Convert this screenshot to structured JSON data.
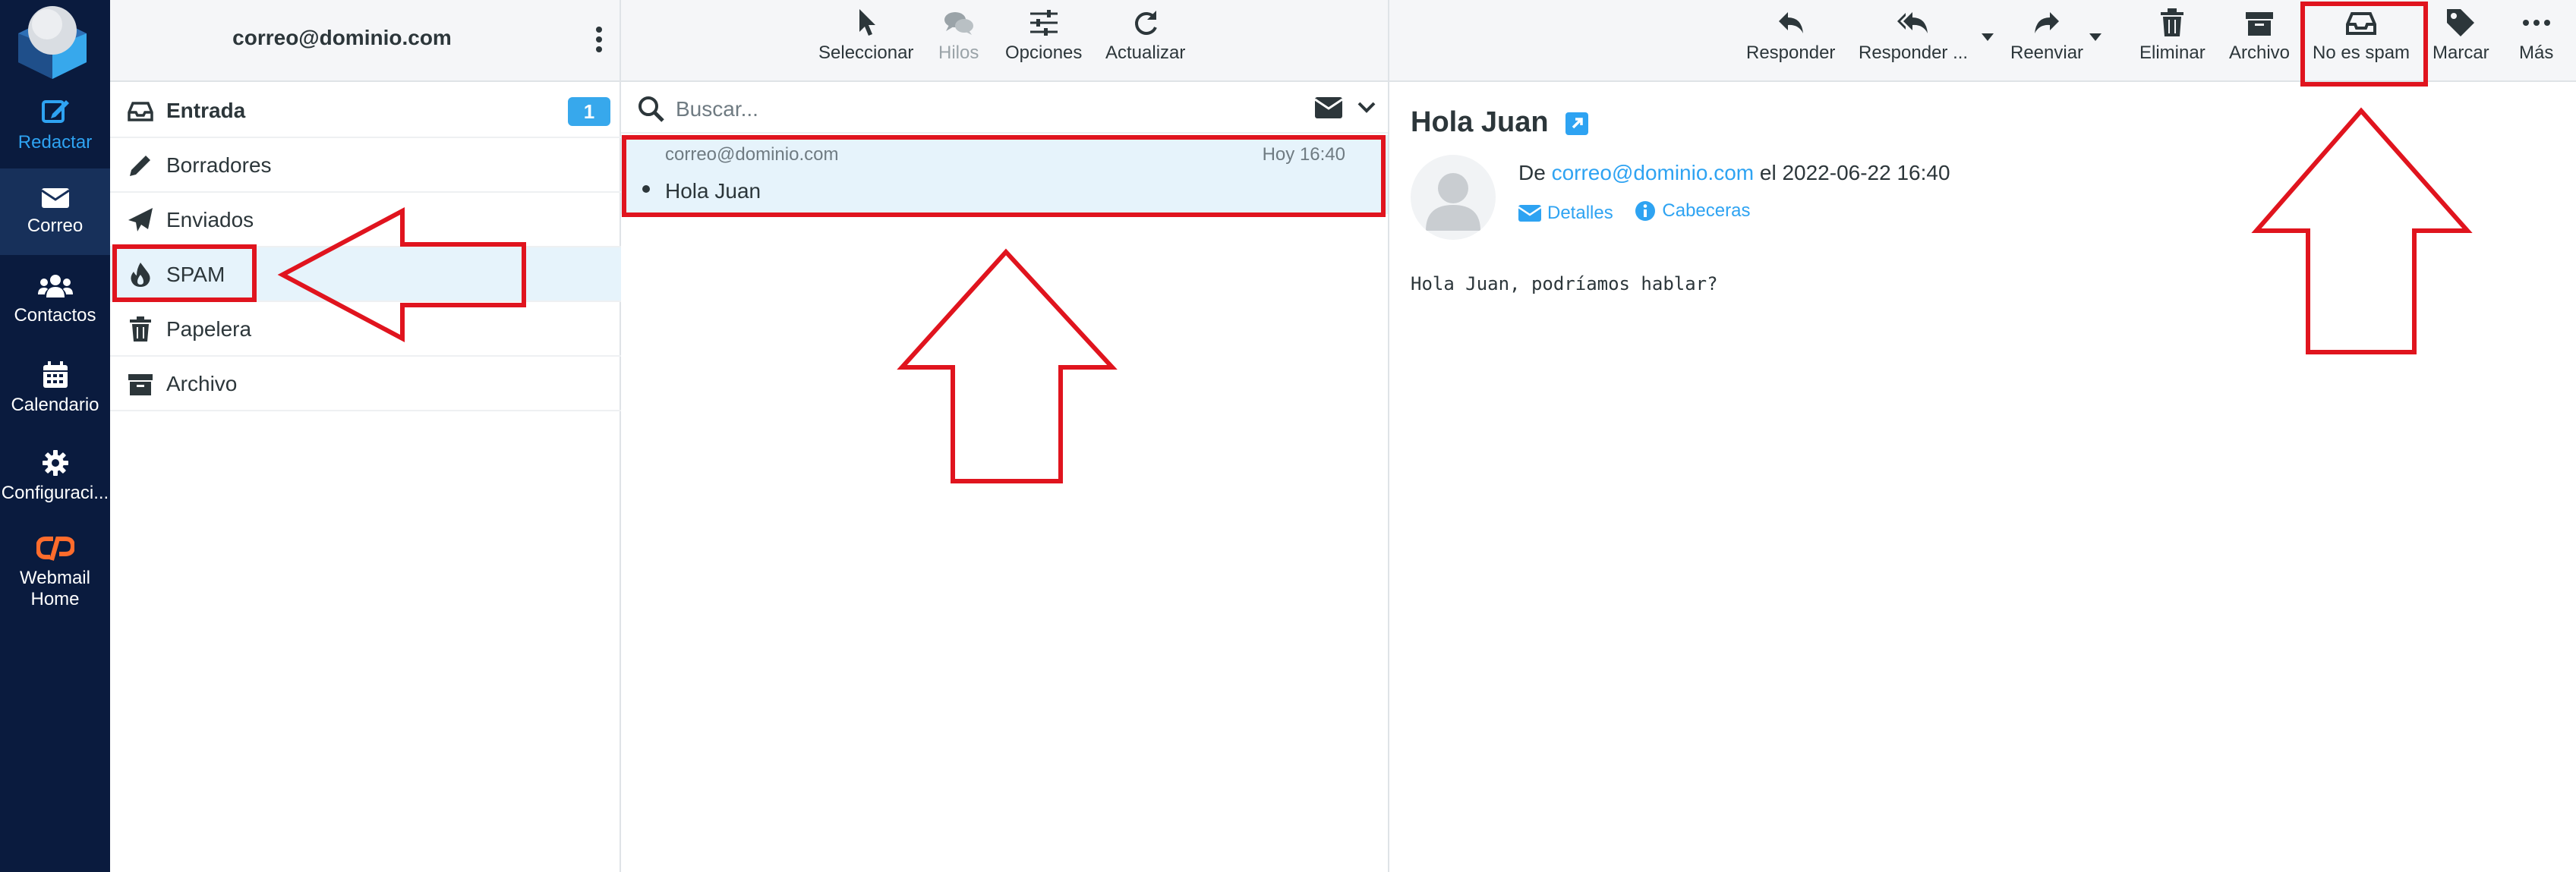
{
  "rail": {
    "items": [
      {
        "label": "Redactar",
        "icon": "compose-icon"
      },
      {
        "label": "Correo",
        "icon": "mail-icon"
      },
      {
        "label": "Contactos",
        "icon": "contacts-icon"
      },
      {
        "label": "Calendario",
        "icon": "calendar-icon"
      },
      {
        "label": "Configuraci...",
        "icon": "gear-icon"
      },
      {
        "label_line1": "Webmail",
        "label_line2": "Home",
        "icon": "cpanel-icon"
      }
    ]
  },
  "folders": {
    "account": "correo@dominio.com",
    "items": [
      {
        "label": "Entrada",
        "icon": "inbox-icon",
        "unread": "1"
      },
      {
        "label": "Borradores",
        "icon": "pencil-icon"
      },
      {
        "label": "Enviados",
        "icon": "paper-plane-icon"
      },
      {
        "label": "SPAM",
        "icon": "fire-icon"
      },
      {
        "label": "Papelera",
        "icon": "trash-icon"
      },
      {
        "label": "Archivo",
        "icon": "archive-icon"
      }
    ]
  },
  "list_toolbar": {
    "select": "Seleccionar",
    "threads": "Hilos",
    "options": "Opciones",
    "refresh": "Actualizar"
  },
  "search": {
    "placeholder": "Buscar..."
  },
  "messages": [
    {
      "from": "correo@dominio.com",
      "date": "Hoy 16:40",
      "subject": "Hola Juan"
    }
  ],
  "reader_toolbar": {
    "reply": "Responder",
    "reply_all": "Responder ...",
    "forward": "Reenviar",
    "delete": "Eliminar",
    "archive": "Archivo",
    "not_spam": "No es spam",
    "mark": "Marcar",
    "more": "Más"
  },
  "reader": {
    "subject": "Hola Juan",
    "from_prefix": "De",
    "from": "correo@dominio.com",
    "date_prefix": "el",
    "date": "2022-06-22 16:40",
    "details": "Detalles",
    "headers": "Cabeceras",
    "body": "Hola Juan, podríamos hablar?"
  },
  "colors": {
    "rail_bg": "#0a1b3e",
    "accent": "#2ea3f2",
    "annotation_red": "#e0141e",
    "selected_bg": "#e6f3fb"
  }
}
